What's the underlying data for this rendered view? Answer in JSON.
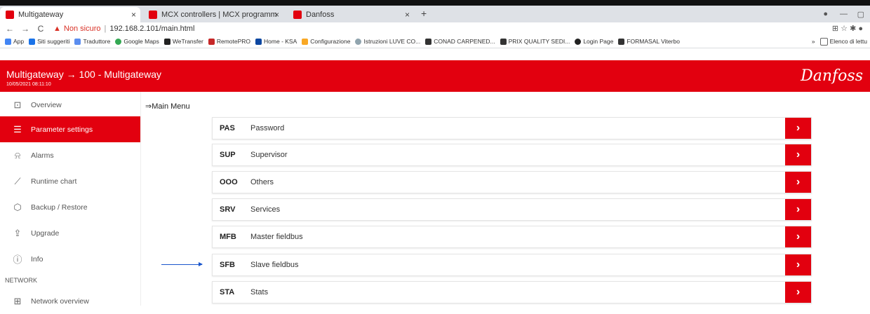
{
  "browser": {
    "tabs": [
      {
        "title": "Multigateway",
        "close": "×"
      },
      {
        "title": "MCX controllers | MCX programm",
        "close": "×"
      },
      {
        "title": "Danfoss",
        "close": "×"
      }
    ],
    "new_tab": "+",
    "security_label": "Non sicuro",
    "url": "192.168.2.101/main.html",
    "bookmarks": [
      "App",
      "Siti suggeriti",
      "Traduttore",
      "Google Maps",
      "WeTransfer",
      "RemotePRO",
      "Home - KSA",
      "Configurazione",
      "Istruzioni LUVE CO...",
      "CONAD CARPENED...",
      "PRIX QUALITY SEDI...",
      "Login Page",
      "FORMASAL Viterbo"
    ],
    "bookmarks_more": "»",
    "reading_list": "Elenco di lettu"
  },
  "header": {
    "title": "Multigateway → 100 - Multigateway",
    "datetime": "10/05/2021 08:11:10",
    "logo": "Danfoss"
  },
  "sidebar": {
    "items": [
      {
        "label": "Overview",
        "icon": "star-box-icon",
        "glyph": "⊡"
      },
      {
        "label": "Parameter settings",
        "icon": "list-icon",
        "glyph": "☰"
      },
      {
        "label": "Alarms",
        "icon": "bell-icon",
        "glyph": "🔔"
      },
      {
        "label": "Runtime chart",
        "icon": "chart-icon",
        "glyph": "⟋"
      },
      {
        "label": "Backup / Restore",
        "icon": "box-icon",
        "glyph": "⬡"
      },
      {
        "label": "Upgrade",
        "icon": "upgrade-icon",
        "glyph": "⇪"
      },
      {
        "label": "Info",
        "icon": "info-icon",
        "glyph": "ⓘ"
      }
    ],
    "section": "NETWORK",
    "network_items": [
      {
        "label": "Network overview",
        "icon": "network-icon",
        "glyph": "⊞"
      }
    ]
  },
  "main": {
    "breadcrumb": "⇒Main Menu",
    "menu": [
      {
        "code": "PAS",
        "label": "Password"
      },
      {
        "code": "SUP",
        "label": "Supervisor"
      },
      {
        "code": "OOO",
        "label": "Others"
      },
      {
        "code": "SRV",
        "label": "Services"
      },
      {
        "code": "MFB",
        "label": "Master fieldbus"
      },
      {
        "code": "SFB",
        "label": "Slave fieldbus"
      },
      {
        "code": "STA",
        "label": "Stats"
      }
    ],
    "go_glyph": "›"
  },
  "colors": {
    "brand": "#e2000f",
    "pointer": "#1a56cc"
  }
}
